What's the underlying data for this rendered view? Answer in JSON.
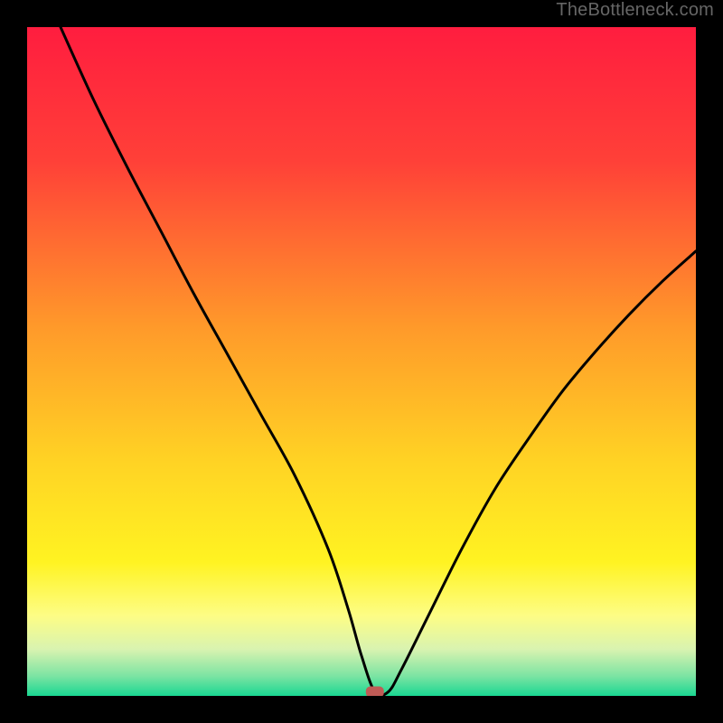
{
  "watermark": "TheBottleneck.com",
  "chart_data": {
    "type": "line",
    "title": "",
    "xlabel": "",
    "ylabel": "",
    "xlim": [
      0,
      100
    ],
    "ylim": [
      0,
      100
    ],
    "marker": {
      "x": 52,
      "y": 0.6
    },
    "series": [
      {
        "name": "curve",
        "x": [
          5,
          10,
          15,
          20,
          25,
          30,
          35,
          40,
          45,
          48,
          50,
          52,
          54,
          56,
          60,
          65,
          70,
          75,
          80,
          85,
          90,
          95,
          100
        ],
        "y": [
          100,
          89,
          79,
          69.5,
          60,
          51,
          42,
          33,
          22,
          13,
          6,
          0.6,
          0.6,
          4,
          12,
          22,
          31,
          38.5,
          45.5,
          51.5,
          57,
          62,
          66.5
        ]
      }
    ],
    "gradient_stops": [
      {
        "offset": 0,
        "color": "#ff1d3f"
      },
      {
        "offset": 20,
        "color": "#ff4038"
      },
      {
        "offset": 45,
        "color": "#ff9a2a"
      },
      {
        "offset": 65,
        "color": "#ffd324"
      },
      {
        "offset": 80,
        "color": "#fff322"
      },
      {
        "offset": 88,
        "color": "#fdfd85"
      },
      {
        "offset": 93,
        "color": "#d9f3b0"
      },
      {
        "offset": 97,
        "color": "#7de4a3"
      },
      {
        "offset": 100,
        "color": "#1ad792"
      }
    ]
  }
}
